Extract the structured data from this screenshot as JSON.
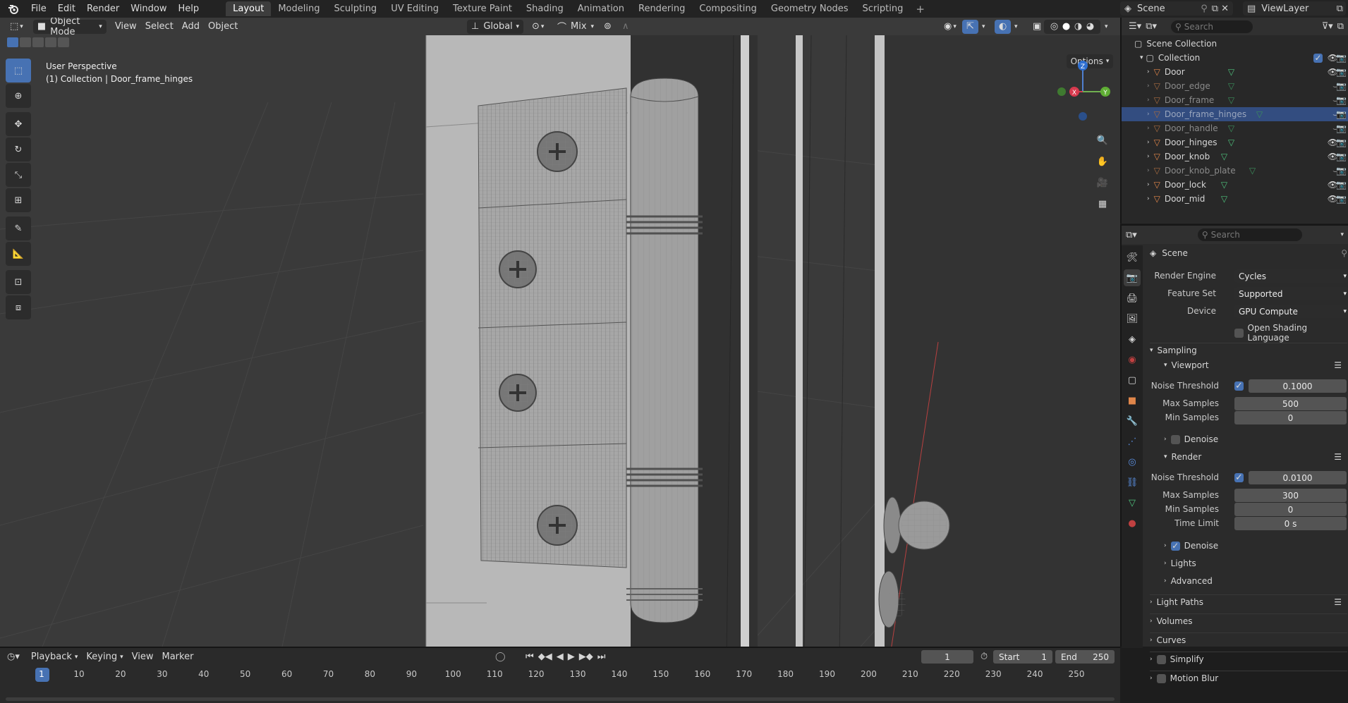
{
  "topbar": {
    "menus": [
      "File",
      "Edit",
      "Render",
      "Window",
      "Help"
    ],
    "workspaces": [
      "Layout",
      "Modeling",
      "Sculpting",
      "UV Editing",
      "Texture Paint",
      "Shading",
      "Animation",
      "Rendering",
      "Compositing",
      "Geometry Nodes",
      "Scripting"
    ],
    "active_workspace": "Layout",
    "scene": "Scene",
    "view_layer": "ViewLayer"
  },
  "viewport": {
    "mode": "Object Mode",
    "menus": [
      "View",
      "Select",
      "Add",
      "Object"
    ],
    "transform_orientation": "Global",
    "snap_mode": "Mix",
    "perspective_label": "User Perspective",
    "context_label": "(1) Collection | Door_frame_hinges",
    "options_label": "Options",
    "gizmo_axes": {
      "x": "X",
      "y": "Y",
      "z": "Z"
    }
  },
  "outliner": {
    "search_placeholder": "Search",
    "root": "Scene Collection",
    "collection": "Collection",
    "objects": [
      {
        "name": "Door",
        "visible": true
      },
      {
        "name": "Door_edge",
        "visible": false
      },
      {
        "name": "Door_frame",
        "visible": false
      },
      {
        "name": "Door_frame_hinges",
        "visible": false,
        "selected": true
      },
      {
        "name": "Door_handle",
        "visible": false
      },
      {
        "name": "Door_hinges",
        "visible": true
      },
      {
        "name": "Door_knob",
        "visible": true
      },
      {
        "name": "Door_knob_plate",
        "visible": false
      },
      {
        "name": "Door_lock",
        "visible": true
      },
      {
        "name": "Door_mid",
        "visible": true
      }
    ]
  },
  "properties": {
    "search_placeholder": "Search",
    "context": "Scene",
    "render_engine_label": "Render Engine",
    "render_engine": "Cycles",
    "feature_set_label": "Feature Set",
    "feature_set": "Supported",
    "device_label": "Device",
    "device": "GPU Compute",
    "osl_label": "Open Shading Language",
    "sampling_label": "Sampling",
    "viewport_label": "Viewport",
    "noise_threshold_label": "Noise Threshold",
    "max_samples_label": "Max Samples",
    "min_samples_label": "Min Samples",
    "time_limit_label": "Time Limit",
    "denoise_label": "Denoise",
    "render_label": "Render",
    "viewport_noise_threshold": "0.1000",
    "viewport_max_samples": "500",
    "viewport_min_samples": "0",
    "render_noise_threshold": "0.0100",
    "render_max_samples": "300",
    "render_min_samples": "0",
    "render_time_limit": "0 s",
    "lights_label": "Lights",
    "advanced_label": "Advanced",
    "light_paths_label": "Light Paths",
    "volumes_label": "Volumes",
    "curves_label": "Curves",
    "simplify_label": "Simplify",
    "motion_blur_label": "Motion Blur"
  },
  "timeline": {
    "menus": [
      "Playback",
      "Keying",
      "View",
      "Marker"
    ],
    "current_frame": "1",
    "start_label": "Start",
    "start": "1",
    "end_label": "End",
    "end": "250",
    "ticks": [
      "1",
      "10",
      "20",
      "30",
      "40",
      "50",
      "60",
      "70",
      "80",
      "90",
      "100",
      "110",
      "120",
      "130",
      "140",
      "150",
      "160",
      "170",
      "180",
      "190",
      "200",
      "210",
      "220",
      "230",
      "240",
      "250"
    ]
  }
}
